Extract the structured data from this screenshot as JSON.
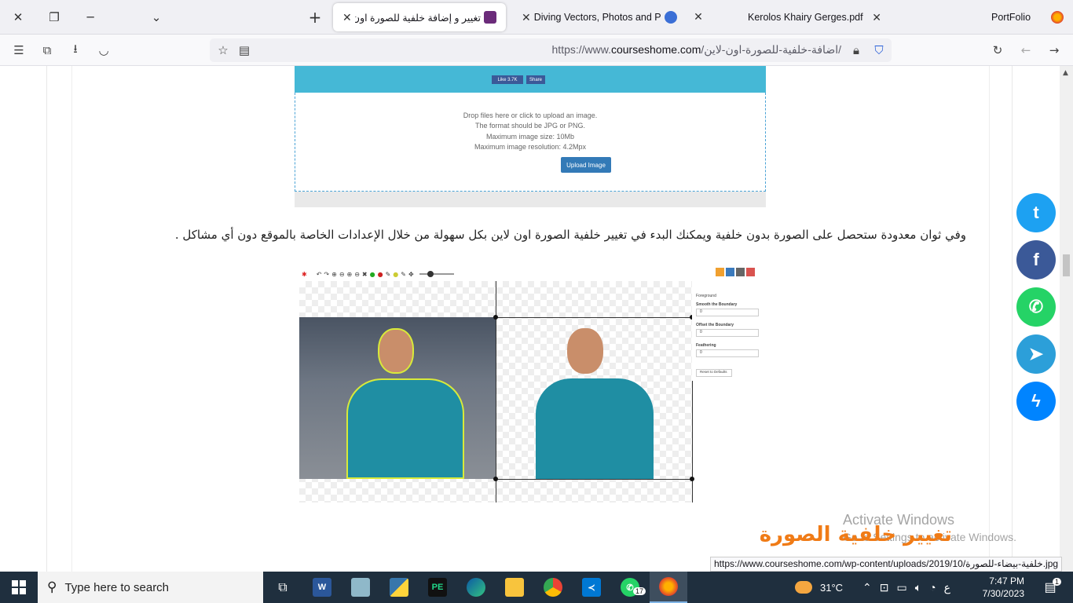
{
  "tabs": [
    {
      "title": "تغيير و إضافة خلفية للصورة اون لا",
      "active": true,
      "favicon_color": "#6b2b7a"
    },
    {
      "title": "Diving Vectors, Photos and PSD",
      "active": false,
      "favicon_color": "#3b6fd6"
    },
    {
      "title": "Kerolos Khairy Gerges.pdf",
      "active": false
    },
    {
      "title": "PortFolio",
      "active": false
    }
  ],
  "url": {
    "prefix": "https://www.",
    "domain": "courseshome.com",
    "path": "/اضافة-خلفية-للصورة-اون-لاين/"
  },
  "upload_box": {
    "like_label": "Like 3.7K",
    "share_label": "Share",
    "lines": [
      "Drop files here or click to upload an image.",
      "The format should be JPG or PNG.",
      "Maximum image size: 10Mb",
      "Maximum image resolution: 4.2Mpx"
    ],
    "button_label": "Upload Image"
  },
  "article": {
    "paragraph": "وفي ثوان معدودة ستحصل على الصورة بدون خلفية ويمكنك البدء في تغيير خلفية الصورة اون لاين بكل سهولة من خلال الإعدادات الخاصة بالموقع دون أي مشاكل .",
    "headline": "تغيير خلفية الصورة"
  },
  "editor_panel": {
    "foreground_label": "Foreground",
    "smooth_label": "Smooth the Boundary",
    "offset_label": "Offset the Boundary",
    "feather_label": "Feathering",
    "smooth_value": "0",
    "offset_value": "0",
    "feather_value": "0",
    "reset_label": "Reset to Defaults"
  },
  "social": [
    {
      "name": "twitter",
      "glyph": "t",
      "color": "#1da1f2"
    },
    {
      "name": "facebook",
      "glyph": "f",
      "color": "#3b5998"
    },
    {
      "name": "whatsapp",
      "glyph": "✆",
      "color": "#25d366"
    },
    {
      "name": "telegram",
      "glyph": "➤",
      "color": "#2c9fd9"
    },
    {
      "name": "messenger",
      "glyph": "ϟ",
      "color": "#0084ff"
    }
  ],
  "watermark": {
    "line1": "Activate Windows",
    "line2": "Go to Settings to activate Windows."
  },
  "status_url": "https://www.courseshome.com/wp-content/uploads/2019/10/خلفية-بيضاء-للصورة.jpg",
  "taskbar": {
    "search_placeholder": "Type here to search",
    "whatsapp_badge": "17",
    "weather": "31°C",
    "lang": "ع",
    "time": "7:47 PM",
    "date": "7/30/2023",
    "notification_count": "1"
  }
}
